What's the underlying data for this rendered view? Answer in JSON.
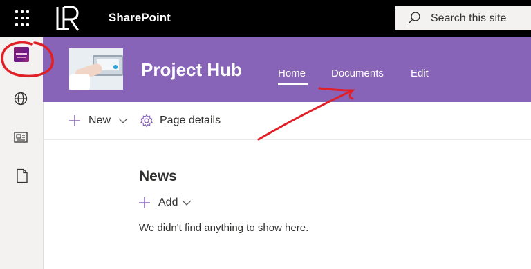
{
  "suite_bar": {
    "app_name": "SharePoint",
    "search_placeholder": "Search this site"
  },
  "site_header": {
    "title": "Project Hub",
    "nav": [
      {
        "label": "Home",
        "selected": true
      },
      {
        "label": "Documents",
        "selected": false
      },
      {
        "label": "Edit",
        "selected": false
      }
    ]
  },
  "command_bar": {
    "new_label": "New",
    "page_details_label": "Page details"
  },
  "news": {
    "title": "News",
    "add_label": "Add",
    "empty_message": "We didn't find anything to show here."
  },
  "colors": {
    "suite_bar": "#000000",
    "header": "#8764b8",
    "accent": "#8764b8",
    "annotation": "#e01f26"
  },
  "icons": {
    "waffle": "app-launcher-icon",
    "search": "search-icon",
    "globe": "globe-icon",
    "news": "news-icon",
    "document": "document-icon",
    "gear": "gear-icon"
  }
}
